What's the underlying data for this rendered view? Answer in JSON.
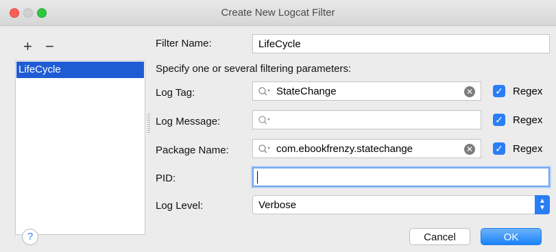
{
  "window": {
    "title": "Create New Logcat Filter"
  },
  "sidebar": {
    "add_symbol": "+",
    "remove_symbol": "−",
    "filters": [
      "LifeCycle"
    ]
  },
  "form": {
    "filter_name": {
      "label": "Filter Name:",
      "value": "LifeCycle"
    },
    "instructions": "Specify one or several filtering parameters:",
    "log_tag": {
      "label": "Log Tag:",
      "value": "StateChange",
      "regex_label": "Regex",
      "regex_checked": true
    },
    "log_message": {
      "label": "Log Message:",
      "value": "",
      "regex_label": "Regex",
      "regex_checked": true
    },
    "package_name": {
      "label": "Package Name:",
      "value": "com.ebookfrenzy.statechange",
      "regex_label": "Regex",
      "regex_checked": true
    },
    "pid": {
      "label": "PID:",
      "value": ""
    },
    "log_level": {
      "label": "Log Level:",
      "selected": "Verbose"
    }
  },
  "buttons": {
    "help": "?",
    "cancel": "Cancel",
    "ok": "OK"
  },
  "icons": {
    "search": "search-icon",
    "clear": "clear-icon",
    "checkbox": "checkmark-icon",
    "select": "chevron-updown-icon"
  },
  "colors": {
    "accent": "#2a7ef6",
    "selection": "#1f5cd4",
    "close": "#fc5f57",
    "zoom": "#2ec840"
  }
}
